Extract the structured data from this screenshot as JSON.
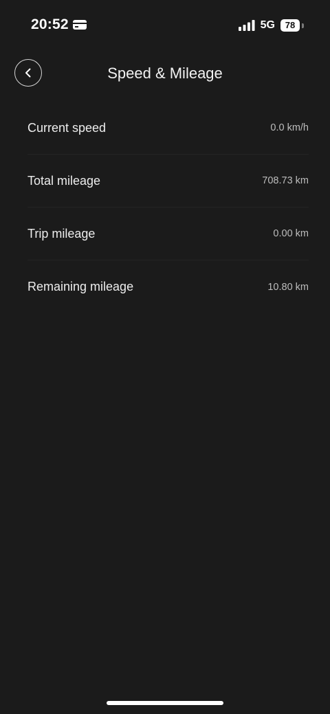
{
  "status_bar": {
    "time": "20:52",
    "network": "5G",
    "battery": "78",
    "icons": [
      "card-icon",
      "signal-icon",
      "battery-icon"
    ]
  },
  "header": {
    "title": "Speed & Mileage",
    "back_icon": "chevron-left-icon"
  },
  "rows": [
    {
      "label": "Current speed",
      "value": "0.0 km/h"
    },
    {
      "label": "Total mileage",
      "value": "708.73 km"
    },
    {
      "label": "Trip mileage",
      "value": "0.00 km"
    },
    {
      "label": "Remaining mileage",
      "value": "10.80 km"
    }
  ],
  "colors": {
    "background": "#1b1b1b",
    "text": "#ededed",
    "value_text": "#bdbdbd",
    "divider": "#242424"
  }
}
